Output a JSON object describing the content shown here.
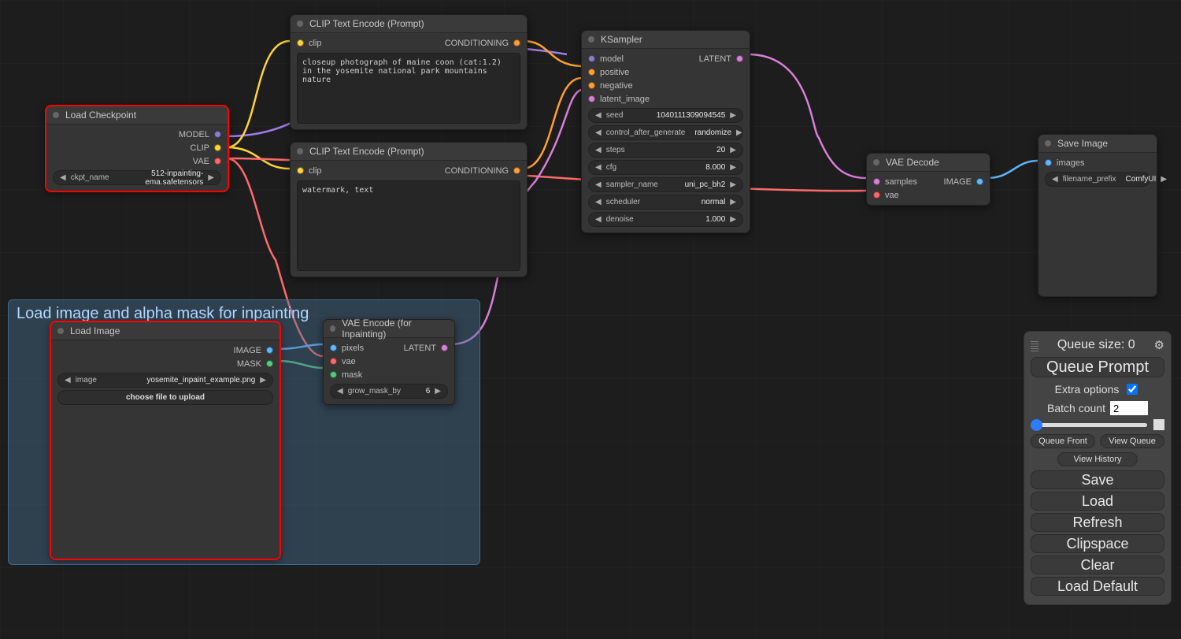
{
  "group": {
    "title": "Load image and alpha mask for inpainting"
  },
  "nodes": {
    "checkpoint": {
      "title": "Load Checkpoint",
      "outputs": [
        "MODEL",
        "CLIP",
        "VAE"
      ],
      "widget": {
        "label": "ckpt_name",
        "value": "512-inpainting-ema.safetensors"
      }
    },
    "clip_pos": {
      "title": "CLIP Text Encode (Prompt)",
      "in": "clip",
      "out": "CONDITIONING",
      "text": "closeup photograph of maine coon (cat:1.2) in the yosemite national park mountains nature"
    },
    "clip_neg": {
      "title": "CLIP Text Encode (Prompt)",
      "in": "clip",
      "out": "CONDITIONING",
      "text": "watermark, text"
    },
    "load_image": {
      "title": "Load Image",
      "outputs": [
        "IMAGE",
        "MASK"
      ],
      "widget": {
        "label": "image",
        "value": "yosemite_inpaint_example.png"
      },
      "btn": "choose file to upload"
    },
    "vae_enc": {
      "title": "VAE Encode (for Inpainting)",
      "ins": [
        "pixels",
        "vae",
        "mask"
      ],
      "out": "LATENT",
      "widget": {
        "label": "grow_mask_by",
        "value": "6"
      }
    },
    "ksampler": {
      "title": "KSampler",
      "ins": [
        "model",
        "positive",
        "negative",
        "latent_image"
      ],
      "out": "LATENT",
      "widgets": [
        {
          "label": "seed",
          "value": "1040111309094545"
        },
        {
          "label": "control_after_generate",
          "value": "randomize"
        },
        {
          "label": "steps",
          "value": "20"
        },
        {
          "label": "cfg",
          "value": "8.000"
        },
        {
          "label": "sampler_name",
          "value": "uni_pc_bh2"
        },
        {
          "label": "scheduler",
          "value": "normal"
        },
        {
          "label": "denoise",
          "value": "1.000"
        }
      ]
    },
    "vae_dec": {
      "title": "VAE Decode",
      "ins": [
        "samples",
        "vae"
      ],
      "out": "IMAGE"
    },
    "save": {
      "title": "Save Image",
      "in": "images",
      "widget": {
        "label": "filename_prefix",
        "value": "ComfyUI"
      }
    }
  },
  "panel": {
    "queue_size_label": "Queue size: 0",
    "queue_prompt": "Queue Prompt",
    "extra_options": "Extra options",
    "batch_count_label": "Batch count",
    "batch_count_value": "2",
    "queue_front": "Queue Front",
    "view_queue": "View Queue",
    "view_history": "View History",
    "save": "Save",
    "load": "Load",
    "refresh": "Refresh",
    "clipspace": "Clipspace",
    "clear": "Clear",
    "load_default": "Load Default"
  }
}
